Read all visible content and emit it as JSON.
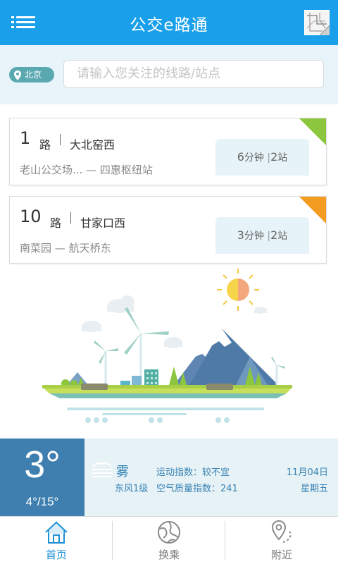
{
  "header": {
    "title": "公交e路通",
    "menu_icon": "menu-icon",
    "map_icon": "subway-map-icon",
    "color": "#1aa0ea"
  },
  "search": {
    "city": "北京",
    "placeholder": "请输入您关注的线路/站点"
  },
  "routes": [
    {
      "number": "1",
      "suffix": "路",
      "destination": "大北窑西",
      "from": "老山公交场...",
      "connector": "—",
      "to": "四惠枢纽站",
      "minutes": "6",
      "minutes_unit": "分钟",
      "stops": "2",
      "stops_unit": "站",
      "corner_color": "#8cc63f"
    },
    {
      "number": "10",
      "suffix": "路",
      "destination": "甘家口西",
      "from": "南菜园",
      "connector": "—",
      "to": "航天桥东",
      "minutes": "3",
      "minutes_unit": "分钟",
      "stops": "2",
      "stops_unit": "站",
      "corner_color": "#f39c1f"
    }
  ],
  "weather": {
    "temp": "3°",
    "range": "4°/15°",
    "condition": "雾",
    "wind": "东风1级",
    "sport_index": "运动指数：较不宜",
    "air_index": "空气质量指数：241",
    "date": "11月04日",
    "weekday": "星期五",
    "condition_icon": "fog-icon"
  },
  "tabs": [
    {
      "label": "首页",
      "icon": "home-icon",
      "active": true
    },
    {
      "label": "换乘",
      "icon": "transfer-globe-icon",
      "active": false
    },
    {
      "label": "附近",
      "icon": "nearby-pin-icon",
      "active": false
    }
  ],
  "colors": {
    "accent": "#1aa0ea",
    "temp_block": "#3f7fb0",
    "search_band": "#e8f4f9"
  }
}
